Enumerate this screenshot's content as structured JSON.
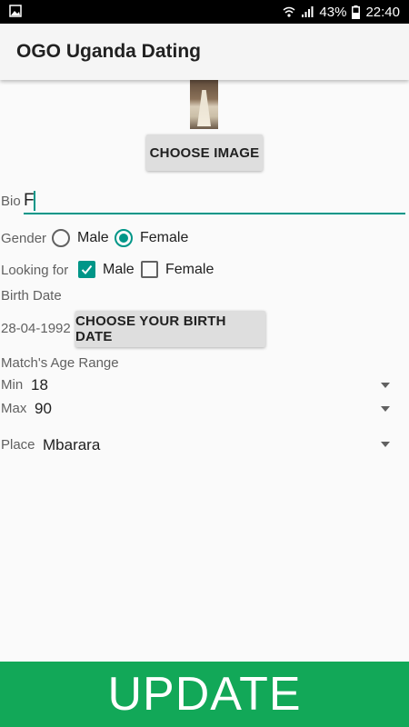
{
  "status_bar": {
    "battery_percent": "43%",
    "time": "22:40",
    "icons": [
      "image-icon",
      "wifi-icon",
      "signal-icon",
      "battery-icon"
    ]
  },
  "app_bar": {
    "title": "OGO Uganda Dating"
  },
  "profile": {
    "choose_image_label": "CHOOSE IMAGE",
    "bio_label": "Bio",
    "bio_value": "F",
    "gender_label": "Gender",
    "gender_options": [
      {
        "label": "Male",
        "selected": false
      },
      {
        "label": "Female",
        "selected": true
      }
    ],
    "looking_for_label": "Looking for",
    "looking_for_options": [
      {
        "label": "Male",
        "checked": true
      },
      {
        "label": "Female",
        "checked": false
      }
    ],
    "birth_date_label": "Birth Date",
    "birth_date_value": "28-04-1992",
    "choose_birth_date_label": "CHOOSE YOUR BIRTH DATE",
    "match_age_range_label": "Match's Age Range",
    "min_label": "Min",
    "min_value": "18",
    "max_label": "Max",
    "max_value": "90",
    "place_label": "Place",
    "place_value": "Mbarara"
  },
  "update_label": "UPDATE",
  "colors": {
    "accent": "#009688",
    "update_bar": "#12a858"
  }
}
